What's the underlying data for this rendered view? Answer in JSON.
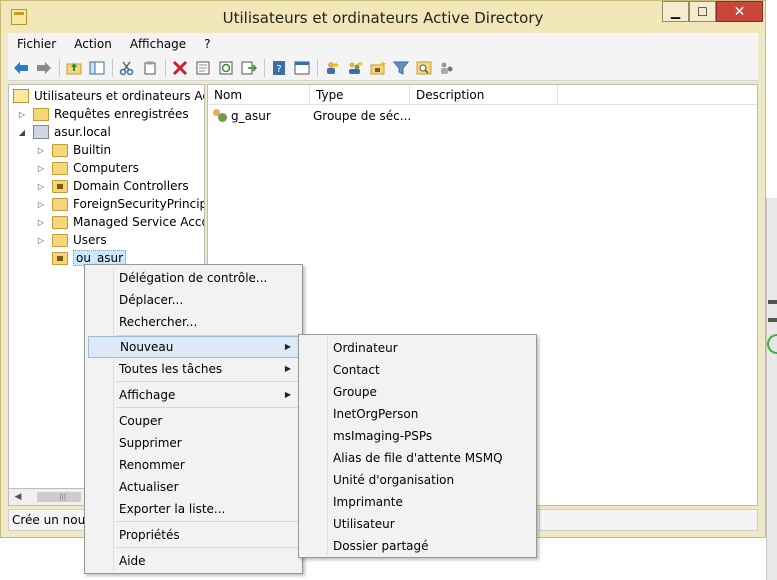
{
  "window": {
    "title": "Utilisateurs et ordinateurs Active Directory",
    "controls": {
      "minimize": "▁",
      "maximize": "☐",
      "close": "✕"
    }
  },
  "menubar": [
    "Fichier",
    "Action",
    "Affichage",
    "?"
  ],
  "toolbar": {
    "icons": [
      "back-arrow-icon",
      "forward-arrow-icon",
      "folder-up-icon",
      "show-tree-icon",
      "cut-icon",
      "copy-icon",
      "delete-icon",
      "properties-icon",
      "refresh-icon",
      "export-icon",
      "help-icon",
      "console-icon",
      "new-user-icon",
      "new-group-icon",
      "new-ou-icon",
      "filter-icon",
      "find-icon",
      "delegate-icon"
    ]
  },
  "tree": {
    "root": "Utilisateurs et ordinateurs Active",
    "saved_queries": "Requêtes enregistrées",
    "domain": "asur.local",
    "children": [
      "Builtin",
      "Computers",
      "Domain Controllers",
      "ForeignSecurityPrincipals",
      "Managed Service Accour",
      "Users",
      "ou_asur"
    ]
  },
  "list": {
    "columns": [
      "Nom",
      "Type",
      "Description"
    ],
    "rows": [
      {
        "name": "g_asur",
        "type": "Groupe de séc...",
        "description": ""
      }
    ]
  },
  "status": {
    "text": "Crée un nouve"
  },
  "context_menu": {
    "items": [
      "Délégation de contrôle...",
      "Déplacer...",
      "Rechercher...",
      "Nouveau",
      "Toutes les tâches",
      "Affichage",
      "Couper",
      "Supprimer",
      "Renommer",
      "Actualiser",
      "Exporter la liste...",
      "Propriétés",
      "Aide"
    ],
    "highlighted": "Nouveau"
  },
  "submenu": {
    "items": [
      "Ordinateur",
      "Contact",
      "Groupe",
      "InetOrgPerson",
      "msImaging-PSPs",
      "Alias de file d'attente MSMQ",
      "Unité d'organisation",
      "Imprimante",
      "Utilisateur",
      "Dossier partagé"
    ]
  },
  "colors": {
    "titlebar": "#f2e7b8",
    "menu_highlight": "#dde9f6",
    "close_button": "#c9463d"
  }
}
